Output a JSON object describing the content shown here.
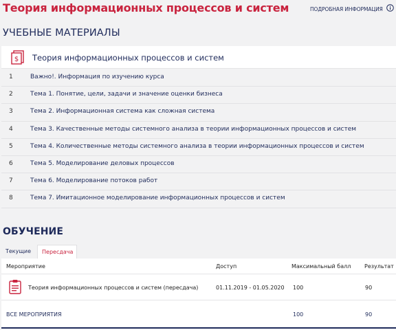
{
  "header": {
    "title": "Теория информационных процессов и систем",
    "info_link": "ПОДРОБНАЯ ИНФОРМАЦИЯ"
  },
  "materials": {
    "heading": "УЧЕБНЫЕ МАТЕРИАЛЫ",
    "course_title": "Теория информационных процессов и систем",
    "items": [
      {
        "num": "1",
        "label": "Важно!. Информация по изучению курса"
      },
      {
        "num": "2",
        "label": "Тема 1. Понятие, цели, задачи и значение оценки бизнеса"
      },
      {
        "num": "3",
        "label": "Тема 2. Информационная система как сложная система"
      },
      {
        "num": "4",
        "label": "Тема 3. Качественные методы системного анализа в теории информационных процессов и систем"
      },
      {
        "num": "5",
        "label": "Тема 4. Количественные методы системного анализа в теории информационных процессов и систем"
      },
      {
        "num": "6",
        "label": "Тема 5. Моделирование деловых процессов"
      },
      {
        "num": "7",
        "label": "Тема 6. Моделирование потоков работ"
      },
      {
        "num": "8",
        "label": "Тема 7. Имитационное моделирование информационных процессов и систем"
      }
    ]
  },
  "training": {
    "heading": "ОБУЧЕНИЕ",
    "tabs": [
      {
        "label": "Текущие",
        "active": false
      },
      {
        "label": "Пересдача",
        "active": true
      }
    ],
    "columns": {
      "event": "Мероприятие",
      "access": "Доступ",
      "max": "Максимальный балл",
      "result": "Результат"
    },
    "rows": [
      {
        "event": "Теория информационных процессов и систем (пересдача)",
        "access": "01.11.2019 - 01.05.2020",
        "max": "100",
        "result": "90"
      }
    ],
    "footer": {
      "label": "ВСЕ МЕРОПРИЯТИЯ",
      "max": "100",
      "result": "90"
    }
  },
  "colors": {
    "accent_red": "#c9243f",
    "navy": "#1e2a5a",
    "background": "#f2f2f3"
  },
  "icons": [
    "info-icon",
    "course-document-icon",
    "clipboard-icon"
  ]
}
